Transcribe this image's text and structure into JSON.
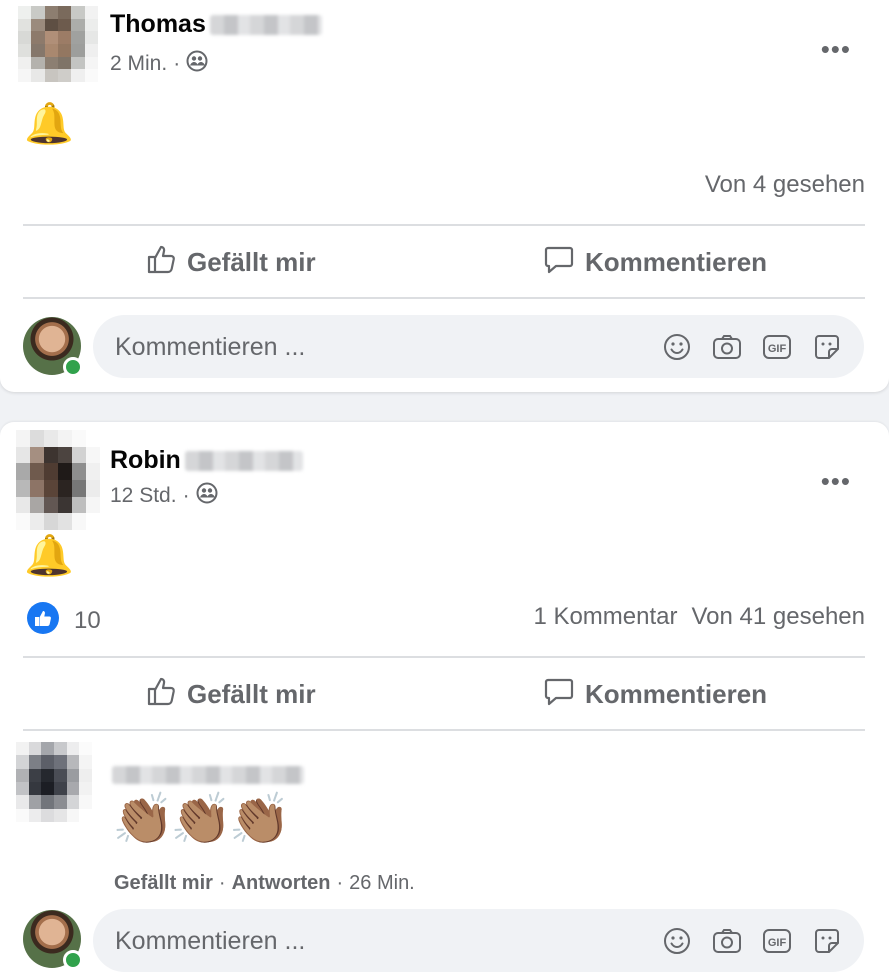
{
  "posts": [
    {
      "author_first": "Thomas",
      "time": "2 Min.",
      "content_emoji": "🔔",
      "seen": "Von 4 gesehen",
      "like_label": "Gefällt mir",
      "comment_label": "Kommentieren",
      "composer_placeholder": "Kommentieren ..."
    },
    {
      "author_first": "Robin",
      "time": "12 Std.",
      "content_emoji": "🔔",
      "reaction_count": "10",
      "comment_count": "1 Kommentar",
      "seen": "Von 41 gesehen",
      "like_label": "Gefällt mir",
      "comment_label": "Kommentieren",
      "comment": {
        "text": "👏🏽👏🏽👏🏽",
        "like": "Gefällt mir",
        "reply": "Antworten",
        "time": "26 Min."
      },
      "composer_placeholder": "Kommentieren ..."
    }
  ],
  "separator": "·",
  "more_glyph": "•••",
  "icons": [
    "more-icon",
    "friends-audience-icon",
    "like-thumb-icon",
    "comment-bubble-icon",
    "emoji-icon",
    "camera-icon",
    "gif-icon",
    "sticker-icon",
    "like-reaction-icon"
  ],
  "colors": {
    "online": "#31a24c",
    "like_blue": "#1877f2",
    "secondary": "#65676b",
    "divider": "#dcdee1"
  }
}
